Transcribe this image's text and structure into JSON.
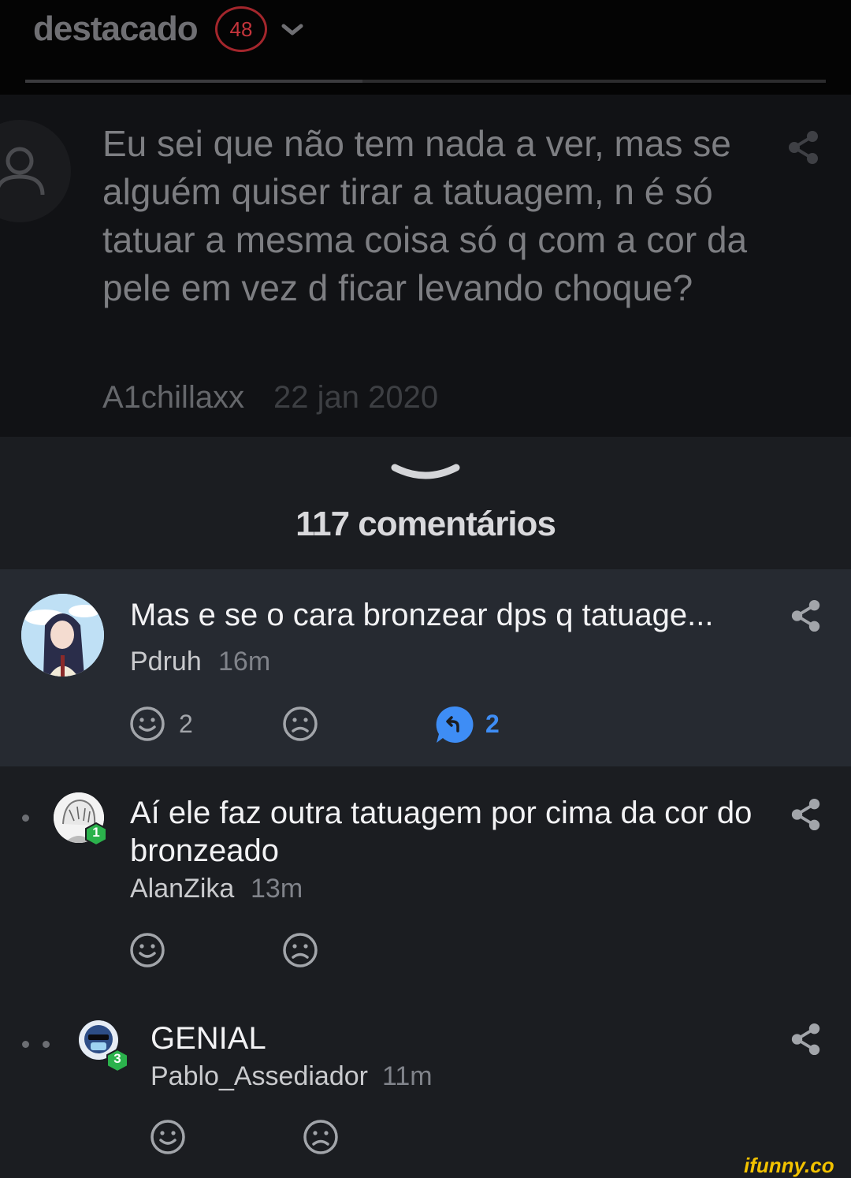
{
  "header": {
    "title": "destacado",
    "badge_count": "48"
  },
  "post": {
    "text": "Eu sei que não tem nada a ver, mas se alguém quiser tirar a tatuagem, n é só tatuar a mesma coisa só q com a cor da pele em vez d ficar levando choque?",
    "author": "A1chillaxx",
    "date": "22 jan 2020"
  },
  "comments_count_label": "117 comentários",
  "comments": [
    {
      "text": "Mas e se o cara bronzear dps q tatuage...",
      "author": "Pdruh",
      "time": "16m",
      "likes": "2",
      "replies": "2"
    },
    {
      "text": "Aí ele faz outra tatuagem por cima da cor do bronzeado",
      "author": "AlanZika",
      "time": "13m",
      "level": "1"
    },
    {
      "text": "GENIAL",
      "author": "Pablo_Assediador",
      "time": "11m",
      "level": "3"
    }
  ],
  "watermark": "ifunny.co",
  "colors": {
    "accent_blue": "#3e8df5",
    "badge_red": "#c4343b",
    "level_green": "#2bb24c"
  }
}
